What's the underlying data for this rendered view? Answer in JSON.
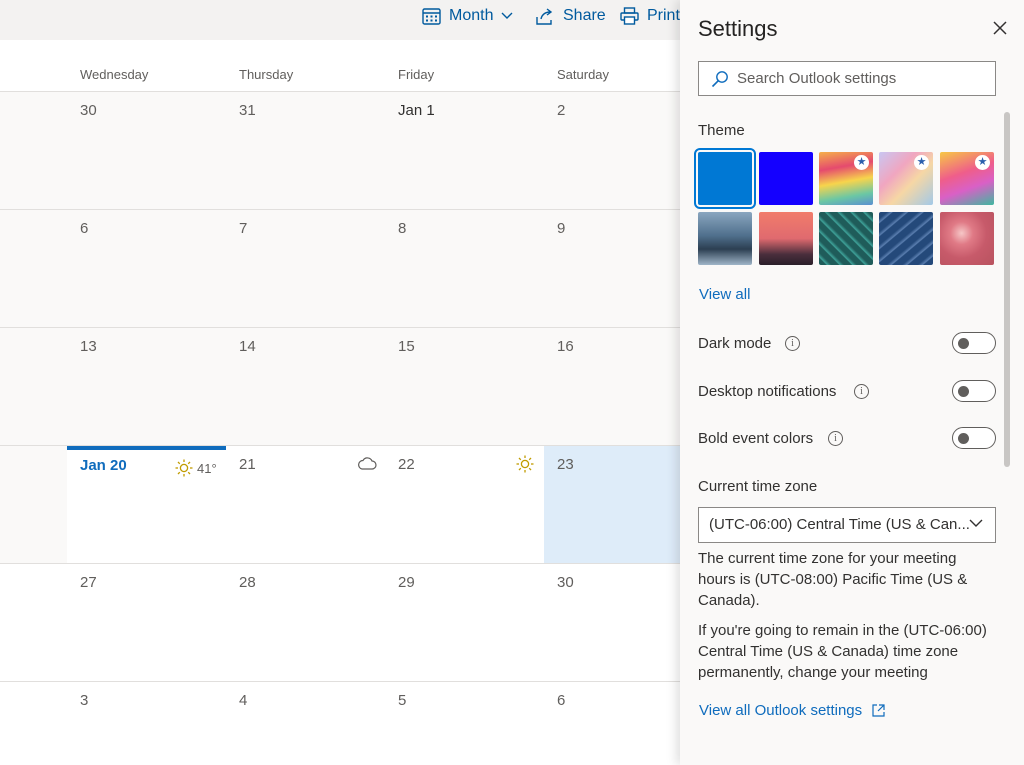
{
  "toolbar": {
    "month_label": "Month",
    "share_label": "Share",
    "print_label": "Print"
  },
  "calendar": {
    "days_of_week": [
      "Wednesday",
      "Thursday",
      "Friday",
      "Saturday"
    ],
    "weeks": [
      [
        "30",
        "31",
        "Jan 1",
        "2"
      ],
      [
        "6",
        "7",
        "8",
        "9"
      ],
      [
        "13",
        "14",
        "15",
        "16"
      ],
      [
        "Jan 20",
        "21",
        "22",
        "23"
      ],
      [
        "27",
        "28",
        "29",
        "30"
      ],
      [
        "3",
        "4",
        "5",
        "6"
      ]
    ],
    "today_weather_temp": "41°"
  },
  "settings": {
    "title": "Settings",
    "search_placeholder": "Search Outlook settings",
    "theme_label": "Theme",
    "view_all": "View all",
    "dark_mode": "Dark mode",
    "desktop_notifications": "Desktop notifications",
    "bold_event_colors": "Bold event colors",
    "time_zone_label": "Current time zone",
    "time_zone_value": "(UTC-06:00) Central Time (US & Can...",
    "tz_note_1": "The current time zone for your meeting hours is (UTC-08:00) Pacific Time (US & Canada).",
    "tz_note_2": "If you're going to remain in the (UTC-06:00) Central Time (US & Canada) time zone permanently, change your meeting",
    "view_all_settings": "View all Outlook settings"
  },
  "colors": {
    "accent": "#0f6cbd",
    "selected_day": "#deecf9",
    "theme_blue": "#0078d4",
    "theme_indigo": "#1400ff"
  }
}
